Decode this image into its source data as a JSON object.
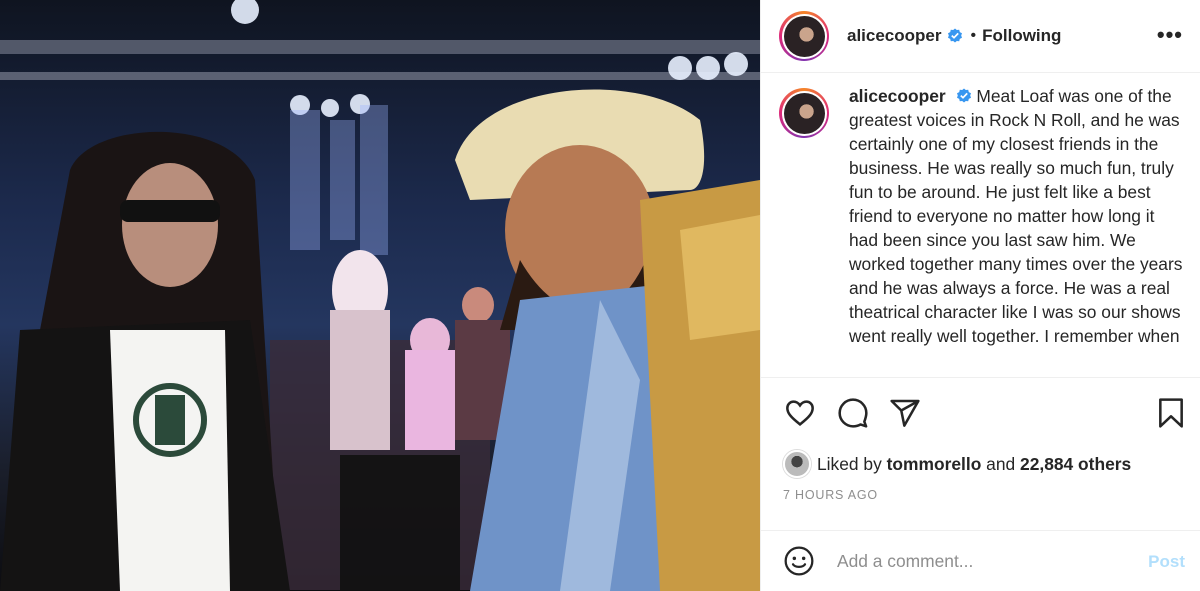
{
  "post": {
    "username": "alicecooper",
    "follow_status": "Following",
    "separator": "•",
    "more_label": "•••",
    "caption": "Meat Loaf was one of the greatest voices in Rock N Roll, and he was certainly one of my closest friends in the business. He was really so much fun, truly fun to be around. He just felt like a best friend to everyone no matter how long it had been since you last saw him. We worked together many times over the years and he was always a force. He was a real theatrical character like I was so our shows went really well together. I remember when",
    "likes": {
      "prefix": "Liked by",
      "liked_by_user": "tommorello",
      "conjunction": "and",
      "others": "22,884 others"
    },
    "timestamp": "7 HOURS AGO"
  },
  "comment": {
    "placeholder": "Add a comment...",
    "post_label": "Post"
  },
  "icons": {
    "like": "heart-icon",
    "comment": "comment-bubble-icon",
    "share": "paper-plane-icon",
    "save": "bookmark-icon",
    "emoji": "emoji-smile-icon",
    "verified": "verified-badge-icon"
  },
  "colors": {
    "verified": "#3897f0",
    "post_disabled": "#b2dffc",
    "muted": "#8e8e8e"
  }
}
